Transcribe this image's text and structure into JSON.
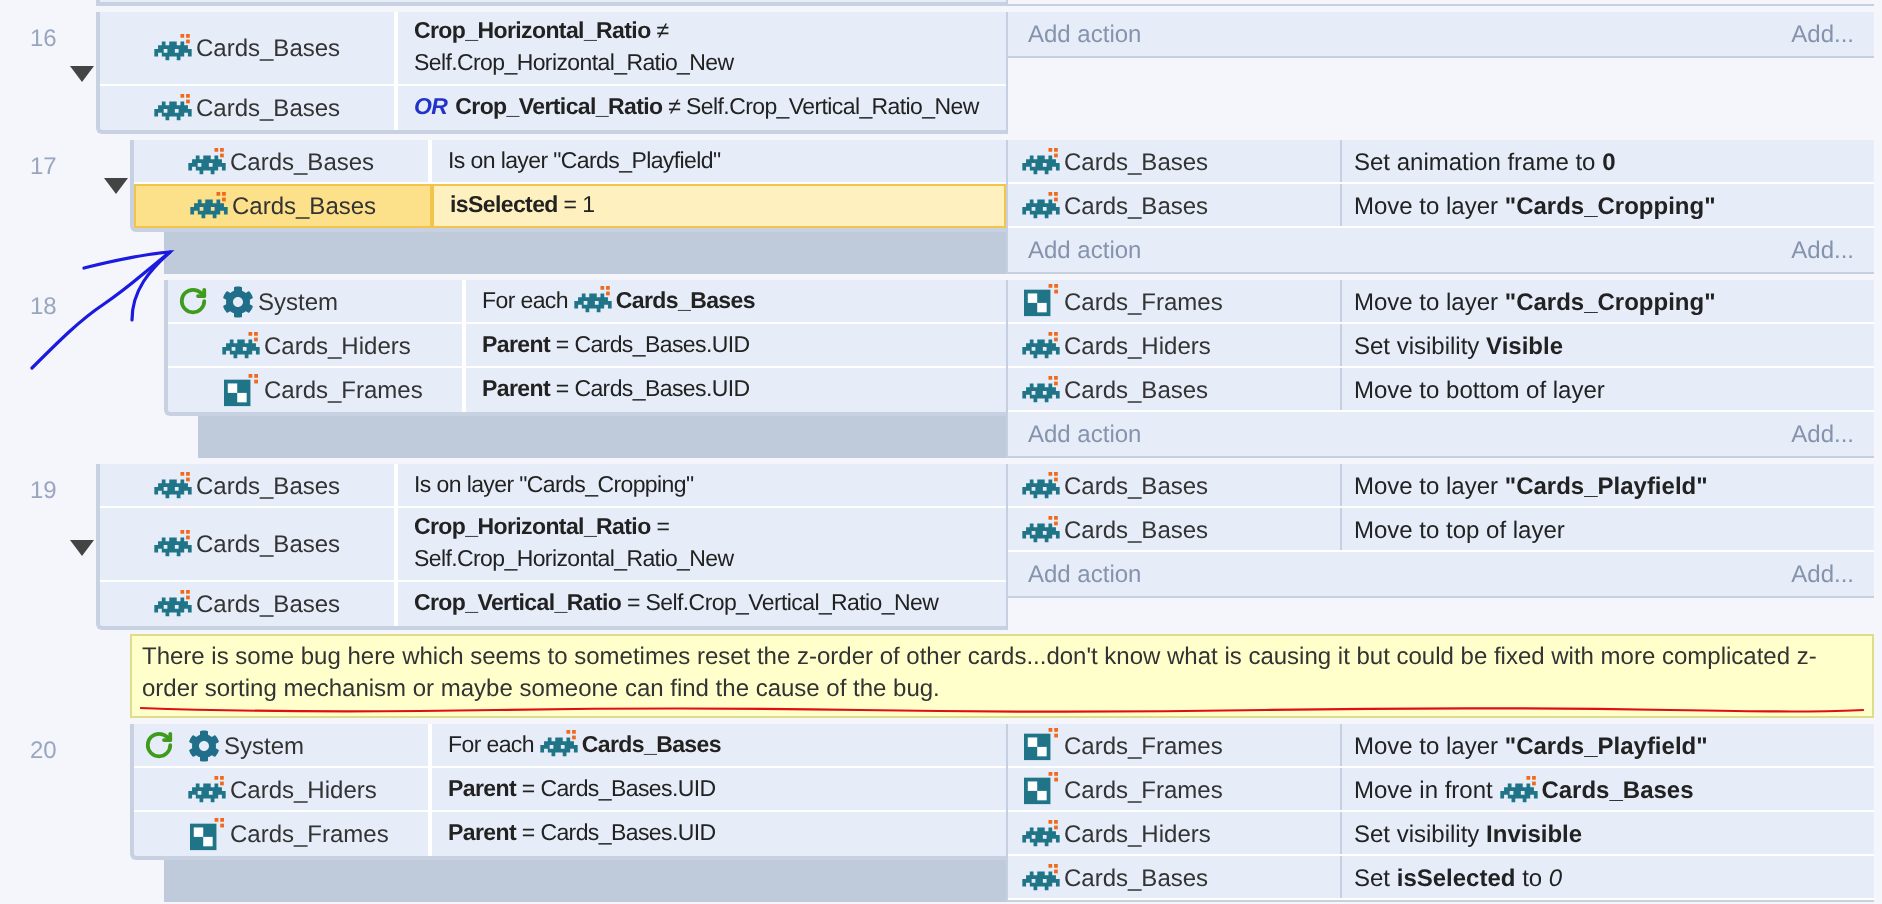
{
  "events": [
    {
      "kind": "event",
      "number": "16",
      "expanded": true,
      "loop": false,
      "conditions": [
        {
          "kind": "sprite",
          "object": "Cards_Bases",
          "text": "**Crop_Horizontal_Ratio** ≠ Self.Crop_Horizontal_Ratio_New",
          "selected": false
        },
        {
          "kind": "sprite",
          "object": "Cards_Bases",
          "or_prefix": "OR",
          "text": "**Crop_Vertical_Ratio** ≠ Self.Crop_Vertical_Ratio_New",
          "selected": false
        }
      ],
      "add_action": {
        "label": "Add action",
        "more": "Add..."
      },
      "children": [
        {
          "kind": "event",
          "number": "17",
          "expanded": true,
          "loop": false,
          "conditions": [
            {
              "kind": "sprite",
              "object": "Cards_Bases",
              "text": "Is on layer \"Cards_Playfield\"",
              "selected": false
            },
            {
              "kind": "sprite",
              "object": "Cards_Bases",
              "text": "**isSelected** = 1",
              "selected": true
            }
          ],
          "actions": [
            {
              "kind": "sprite",
              "object": "Cards_Bases",
              "text": "Set animation frame to **0**"
            },
            {
              "kind": "sprite",
              "object": "Cards_Bases",
              "text": "Move to layer **\"Cards_Cropping\"**"
            }
          ],
          "add_action": {
            "label": "Add action",
            "more": "Add..."
          },
          "children": [
            {
              "kind": "event",
              "number": "18",
              "expanded": false,
              "loop": true,
              "conditions": [
                {
                  "kind": "system",
                  "object": "System",
                  "text": "For each",
                  "target": "Cards_Bases",
                  "selected": false
                },
                {
                  "kind": "sprite",
                  "object": "Cards_Hiders",
                  "text": "**Parent** = Cards_Bases.UID",
                  "selected": false
                },
                {
                  "kind": "tiled",
                  "object": "Cards_Frames",
                  "text": "**Parent** = Cards_Bases.UID",
                  "selected": false
                }
              ],
              "actions": [
                {
                  "kind": "tiled",
                  "object": "Cards_Frames",
                  "text": "Move to layer **\"Cards_Cropping\"**"
                },
                {
                  "kind": "sprite",
                  "object": "Cards_Hiders",
                  "text": "Set visibility **Visible**"
                },
                {
                  "kind": "sprite",
                  "object": "Cards_Bases",
                  "text": "Move to bottom of layer"
                }
              ],
              "add_action": {
                "label": "Add action",
                "more": "Add..."
              }
            }
          ]
        }
      ]
    },
    {
      "kind": "event",
      "number": "19",
      "expanded": true,
      "loop": false,
      "conditions": [
        {
          "kind": "sprite",
          "object": "Cards_Bases",
          "text": "Is on layer \"Cards_Cropping\"",
          "selected": false
        },
        {
          "kind": "sprite",
          "object": "Cards_Bases",
          "text": "**Crop_Horizontal_Ratio** = Self.Crop_Horizontal_Ratio_New",
          "selected": false
        },
        {
          "kind": "sprite",
          "object": "Cards_Bases",
          "text": "**Crop_Vertical_Ratio** = Self.Crop_Vertical_Ratio_New",
          "selected": false
        }
      ],
      "actions": [
        {
          "kind": "sprite",
          "object": "Cards_Bases",
          "text": "Move to layer **\"Cards_Playfield\"**"
        },
        {
          "kind": "sprite",
          "object": "Cards_Bases",
          "text": "Move to top of layer"
        }
      ],
      "add_action": {
        "label": "Add action",
        "more": "Add..."
      },
      "children": [
        {
          "kind": "comment",
          "text": "There is some bug here which seems to sometimes reset the z-order of other cards...don't know what is causing it but could be fixed with more complicated z-order sorting mechanism or maybe someone can find the cause of the bug."
        },
        {
          "kind": "event",
          "number": "20",
          "expanded": false,
          "loop": true,
          "conditions": [
            {
              "kind": "system",
              "object": "System",
              "text": "For each",
              "target": "Cards_Bases",
              "selected": false
            },
            {
              "kind": "sprite",
              "object": "Cards_Hiders",
              "text": "**Parent** = Cards_Bases.UID",
              "selected": false
            },
            {
              "kind": "tiled",
              "object": "Cards_Frames",
              "text": "**Parent** = Cards_Bases.UID",
              "selected": false
            }
          ],
          "actions": [
            {
              "kind": "tiled",
              "object": "Cards_Frames",
              "text": "Move to layer **\"Cards_Playfield\"**"
            },
            {
              "kind": "tiled",
              "object": "Cards_Frames",
              "text": "Move in front",
              "target": "Cards_Bases"
            },
            {
              "kind": "sprite",
              "object": "Cards_Hiders",
              "text": "Set visibility **Invisible**"
            },
            {
              "kind": "sprite",
              "object": "Cards_Bases",
              "text": "Set **isSelected** to *0*"
            }
          ]
        }
      ]
    }
  ]
}
